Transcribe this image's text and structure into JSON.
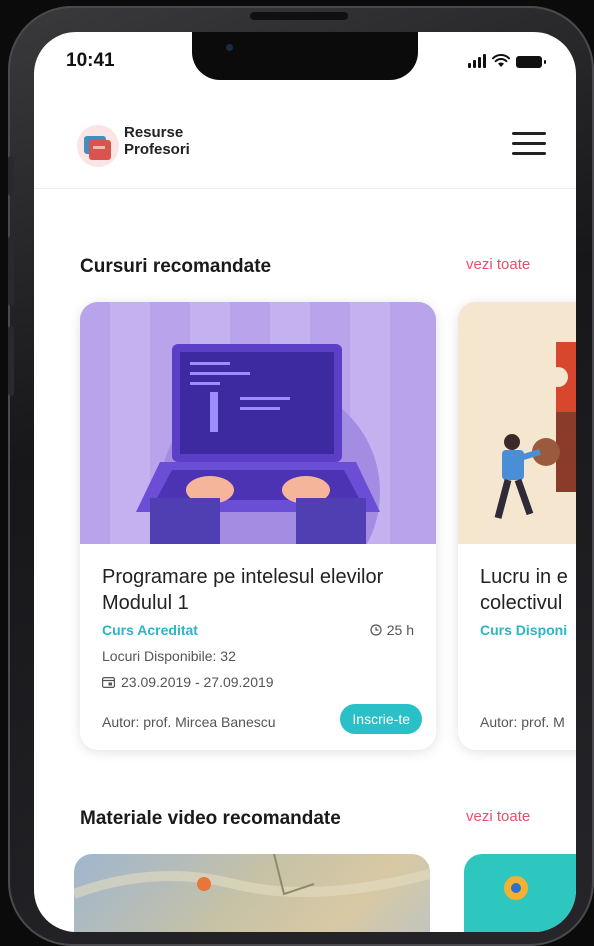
{
  "status_bar": {
    "time": "10:41"
  },
  "brand": {
    "line1": "Resurse",
    "line2": "Profesori"
  },
  "sections": {
    "courses": {
      "title": "Cursuri recomandate",
      "see_all": "vezi toate"
    },
    "videos": {
      "title": "Materiale video recomandate",
      "see_all": "vezi toate"
    }
  },
  "courses": [
    {
      "title_line1": "Programare pe intelesul elevilor",
      "title_line2": "Modulul 1",
      "status": "Curs Acreditat",
      "duration": "25 h",
      "seats": "Locuri Disponibile: 32",
      "dates": "23.09.2019 - 27.09.2019",
      "author": "Autor: prof. Mircea Banescu",
      "cta": "Inscrie-te"
    },
    {
      "title_line1": "Lucru in e",
      "title_line2": "colectivul",
      "status": "Curs Disponi",
      "author": "Autor: prof. M"
    }
  ],
  "colors": {
    "accent": "#29c0c8",
    "link": "#e8506a",
    "card_purple": "#b9a4ec",
    "card_beige": "#f5e6cf"
  }
}
